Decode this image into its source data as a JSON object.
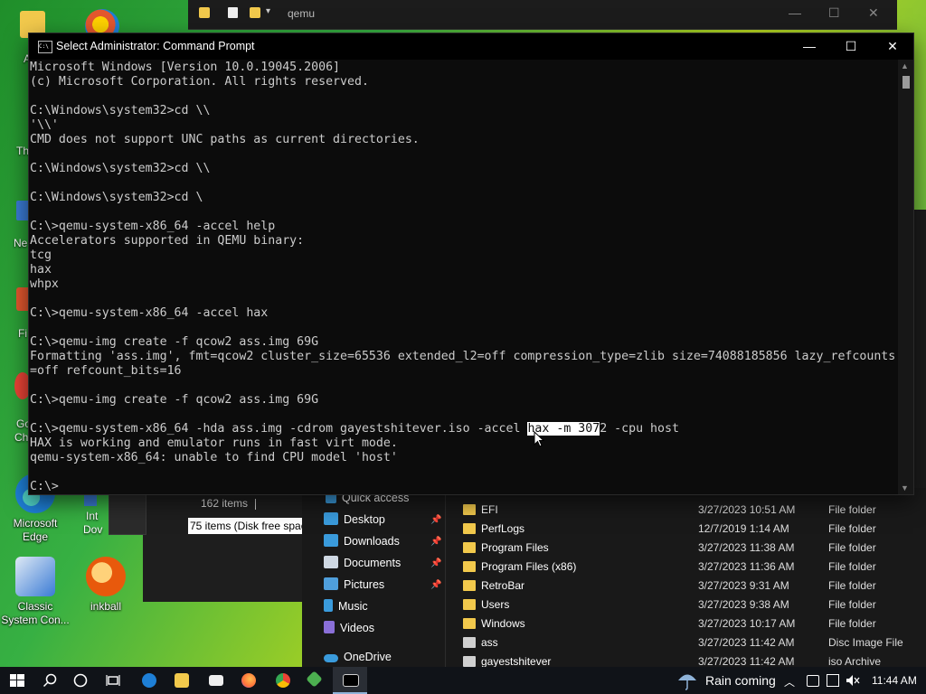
{
  "desktop": {
    "icons": [
      {
        "label": "Microsoft Edge",
        "icon": "edge-icon",
        "color": "#1e7fd6"
      },
      {
        "label": "Classic System Con...",
        "icon": "control-panel-icon",
        "color": "#3a7bd5"
      },
      {
        "label": "inkball",
        "icon": "inkball-icon",
        "color": "#f39c12"
      }
    ],
    "partial_labels": [
      "Th",
      "Ne",
      "Fi",
      "Go",
      "Ch",
      "Int",
      "Dov",
      "A"
    ]
  },
  "explorer_bg": {
    "title": "qemu",
    "item_count": "162 items",
    "status2": "75 items (Disk free spac",
    "nav": [
      {
        "label": "Quick access",
        "icon": "star-icon",
        "pinned": false
      },
      {
        "label": "Desktop",
        "icon": "desktop-icon",
        "pinned": true
      },
      {
        "label": "Downloads",
        "icon": "download-icon",
        "pinned": true
      },
      {
        "label": "Documents",
        "icon": "documents-icon",
        "pinned": true
      },
      {
        "label": "Pictures",
        "icon": "pictures-icon",
        "pinned": true
      },
      {
        "label": "Music",
        "icon": "music-icon",
        "pinned": false
      },
      {
        "label": "Videos",
        "icon": "videos-icon",
        "pinned": false
      },
      {
        "label": "OneDrive",
        "icon": "onedrive-icon",
        "pinned": false
      }
    ],
    "files": [
      {
        "name": "EFI",
        "date": "3/27/2023 10:51 AM",
        "type": "File folder"
      },
      {
        "name": "PerfLogs",
        "date": "12/7/2019 1:14 AM",
        "type": "File folder"
      },
      {
        "name": "Program Files",
        "date": "3/27/2023 11:38 AM",
        "type": "File folder"
      },
      {
        "name": "Program Files (x86)",
        "date": "3/27/2023 11:36 AM",
        "type": "File folder"
      },
      {
        "name": "RetroBar",
        "date": "3/27/2023 9:31 AM",
        "type": "File folder"
      },
      {
        "name": "Users",
        "date": "3/27/2023 9:38 AM",
        "type": "File folder"
      },
      {
        "name": "Windows",
        "date": "3/27/2023 10:17 AM",
        "type": "File folder"
      },
      {
        "name": "ass",
        "date": "3/27/2023 11:42 AM",
        "type": "Disc Image File"
      },
      {
        "name": "gayestshitever",
        "date": "3/27/2023 11:42 AM",
        "type": "iso Archive"
      }
    ]
  },
  "cmd": {
    "title": "Select Administrator: Command Prompt",
    "lines": [
      "Microsoft Windows [Version 10.0.19045.2006]",
      "(c) Microsoft Corporation. All rights reserved.",
      "",
      "C:\\Windows\\system32>cd \\\\",
      "'\\\\'",
      "CMD does not support UNC paths as current directories.",
      "",
      "C:\\Windows\\system32>cd \\\\",
      "",
      "C:\\Windows\\system32>cd \\",
      "",
      "C:\\>qemu-system-x86_64 -accel help",
      "Accelerators supported in QEMU binary:",
      "tcg",
      "hax",
      "whpx",
      "",
      "C:\\>qemu-system-x86_64 -accel hax",
      "",
      "C:\\>qemu-img create -f qcow2 ass.img 69G",
      "Formatting 'ass.img', fmt=qcow2 cluster_size=65536 extended_l2=off compression_type=zlib size=74088185856 lazy_refcounts",
      "=off refcount_bits=16",
      "",
      "C:\\>qemu-img create -f qcow2 ass.img 69G",
      ""
    ],
    "sel_line": {
      "before": "C:\\>qemu-system-x86_64 -hda ass.img -cdrom gayestshitever.iso -accel ",
      "selected": "hax -m 307",
      "after": "2 -cpu host"
    },
    "lines_after": [
      "HAX is working and emulator runs in fast virt mode.",
      "qemu-system-x86_64: unable to find CPU model 'host'",
      "",
      "C:\\>"
    ]
  },
  "taskbar": {
    "weather": "Rain coming",
    "time": "11:44 AM",
    "apps": [
      {
        "name": "start-button",
        "color": "#ffffff"
      },
      {
        "name": "search-button",
        "color": "#ffffff"
      },
      {
        "name": "cortana-button",
        "color": "#ffffff"
      },
      {
        "name": "task-view-button",
        "color": "#ffffff"
      },
      {
        "name": "edge-taskbar-icon",
        "color": "#1e7fd6"
      },
      {
        "name": "file-explorer-taskbar-icon",
        "color": "#f2c94c"
      },
      {
        "name": "mail-taskbar-icon",
        "color": "#eeeeee"
      },
      {
        "name": "firefox-taskbar-icon",
        "color": "#ff7139"
      },
      {
        "name": "chrome-taskbar-icon",
        "color": "#34a853"
      },
      {
        "name": "app-taskbar-icon",
        "color": "#4caf50"
      },
      {
        "name": "cmd-taskbar-icon",
        "color": "#cfcfcf"
      }
    ]
  }
}
